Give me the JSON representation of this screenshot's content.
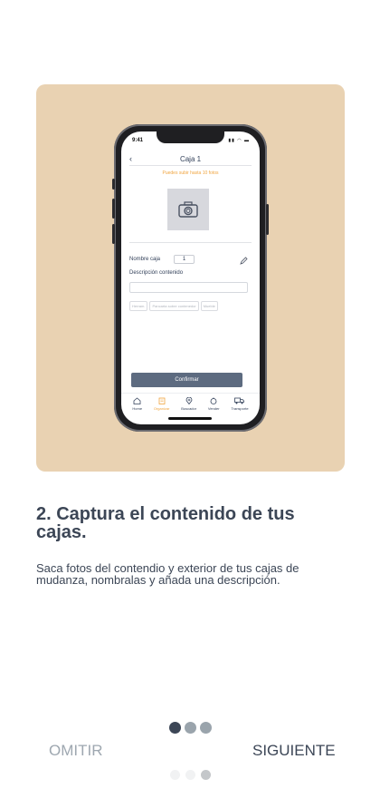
{
  "phone_screen": {
    "status_time": "9:41",
    "status_icons": "▮▮ ◠ ▬",
    "back_icon": "chevron-left-icon",
    "title": "Caja 1",
    "hint": "Puedes subir hasta 10 fotos",
    "photo_icon": "camera-icon",
    "name_label": "Nombre caja",
    "name_value": "1",
    "edit_icon": "pencil-icon",
    "description_label": "Descripción contenido",
    "chips": [
      "Herram.",
      "Pancarta sobre contenedor",
      "Mueble"
    ],
    "confirm_label": "Confirmar",
    "tabs": [
      {
        "label": "Home",
        "icon": "home-icon",
        "active": false
      },
      {
        "label": "Organizar",
        "icon": "clipboard-icon",
        "active": true
      },
      {
        "label": "Buscador",
        "icon": "location-pin-icon",
        "active": false
      },
      {
        "label": "Vender",
        "icon": "price-tag-icon",
        "active": false
      },
      {
        "label": "Transporte",
        "icon": "truck-icon",
        "active": false
      }
    ]
  },
  "heading": "2. Captura el contenido de tus cajas.",
  "description": "Saca fotos del contendio y exterior de tus cajas de mudanza, nombralas y añada una descripción.",
  "pagination": {
    "total": 3,
    "active_index": 0
  },
  "footer": {
    "skip_label": "OMITIR",
    "next_label": "SIGUIENTE"
  },
  "bottom_pager": {
    "total": 3,
    "active_index": 2
  },
  "colors": {
    "hero_background": "#e9d2b2",
    "text_primary": "#3c4656",
    "text_muted": "#9ea7b0",
    "accent_orange": "#f0a540",
    "button_slate": "#5d6b80"
  }
}
